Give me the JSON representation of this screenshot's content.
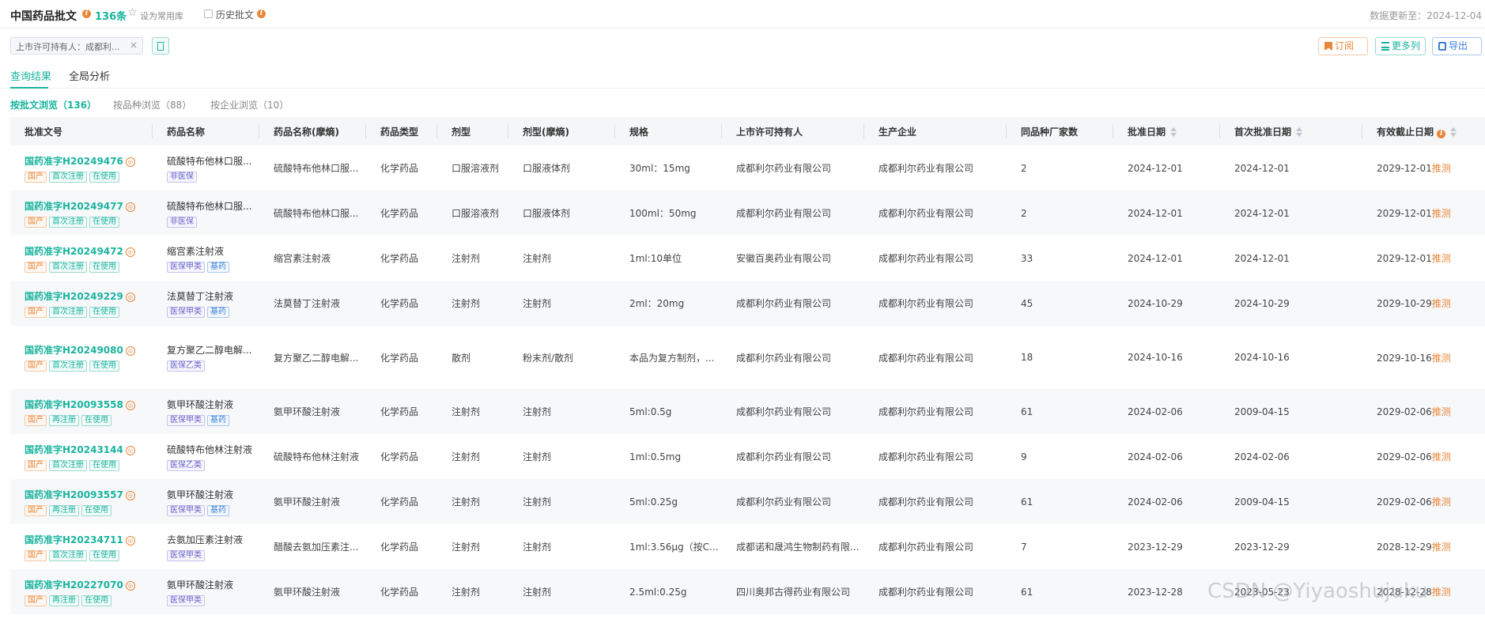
{
  "header": {
    "title": "中国药品批文",
    "count": "136条",
    "set_favorite": "设为常用库",
    "history": "历史批文",
    "updated": "数据更新至：2024-12-04"
  },
  "filter": {
    "chip": "上市许可持有人：成都利...",
    "chip_close": "×"
  },
  "actions": {
    "subscribe": "订阅",
    "more_columns": "更多列",
    "export": "导出"
  },
  "tabs": [
    "查询结果",
    "全局分析"
  ],
  "subtabs": [
    "按批文浏览（136）",
    "按品种浏览（88）",
    "按企业浏览（10）"
  ],
  "columns": [
    "批准文号",
    "药品名称",
    "药品名称(摩熵)",
    "药品类型",
    "剂型",
    "剂型(摩熵)",
    "规格",
    "上市许可持有人",
    "生产企业",
    "同品种厂家数",
    "批准日期",
    "首次批准日期",
    "有效截止日期"
  ],
  "rows": [
    {
      "approval": "国药准字H20249476",
      "tags": [
        "国产",
        "首次注册",
        "在使用"
      ],
      "name": "硫酸特布他林口服...",
      "name_tags": [
        "非医保"
      ],
      "name_ms": "硫酸特布他林口服...",
      "type": "化学药品",
      "form": "口服溶液剂",
      "form_ms": "口服液体剂",
      "spec": "30ml：15mg",
      "holder": "成都利尔药业有限公司",
      "maker": "成都利尔药业有限公司",
      "count": "2",
      "approve_date": "2024-12-01",
      "first_date": "2024-12-01",
      "expire_date": "2029-12-01",
      "predict": "推测"
    },
    {
      "approval": "国药准字H20249477",
      "tags": [
        "国产",
        "首次注册",
        "在使用"
      ],
      "name": "硫酸特布他林口服...",
      "name_tags": [
        "非医保"
      ],
      "name_ms": "硫酸特布他林口服...",
      "type": "化学药品",
      "form": "口服溶液剂",
      "form_ms": "口服液体剂",
      "spec": "100ml：50mg",
      "holder": "成都利尔药业有限公司",
      "maker": "成都利尔药业有限公司",
      "count": "2",
      "approve_date": "2024-12-01",
      "first_date": "2024-12-01",
      "expire_date": "2029-12-01",
      "predict": "推测"
    },
    {
      "approval": "国药准字H20249472",
      "tags": [
        "国产",
        "首次注册",
        "在使用"
      ],
      "name": "缩宫素注射液",
      "name_tags": [
        "医保甲类",
        "基药"
      ],
      "name_ms": "缩宫素注射液",
      "type": "化学药品",
      "form": "注射剂",
      "form_ms": "注射剂",
      "spec": "1ml:10单位",
      "holder": "安徽百奥药业有限公司",
      "maker": "成都利尔药业有限公司",
      "count": "33",
      "approve_date": "2024-12-01",
      "first_date": "2024-12-01",
      "expire_date": "2029-12-01",
      "predict": "推测"
    },
    {
      "approval": "国药准字H20249229",
      "tags": [
        "国产",
        "首次注册",
        "在使用"
      ],
      "name": "法莫替丁注射液",
      "name_tags": [
        "医保甲类",
        "基药"
      ],
      "name_ms": "法莫替丁注射液",
      "type": "化学药品",
      "form": "注射剂",
      "form_ms": "注射剂",
      "spec": "2ml：20mg",
      "holder": "成都利尔药业有限公司",
      "maker": "成都利尔药业有限公司",
      "count": "45",
      "approve_date": "2024-10-29",
      "first_date": "2024-10-29",
      "expire_date": "2029-10-29",
      "predict": "推测"
    },
    {
      "approval": "国药准字H20249080",
      "tags": [
        "国产",
        "首次注册",
        "在使用"
      ],
      "name": "复方聚乙二醇电解...",
      "name_tags": [
        "医保乙类"
      ],
      "name_ms": "复方聚乙二醇电解...",
      "type": "化学药品",
      "form": "散剂",
      "form_ms": "粉末剂/散剂",
      "spec": "本品为复方制剂，...",
      "holder": "成都利尔药业有限公司",
      "maker": "成都利尔药业有限公司",
      "count": "18",
      "approve_date": "2024-10-16",
      "first_date": "2024-10-16",
      "expire_date": "2029-10-16",
      "predict": "推测"
    },
    {
      "approval": "国药准字H20093558",
      "tags": [
        "国产",
        "再注册",
        "在使用"
      ],
      "name": "氨甲环酸注射液",
      "name_tags": [
        "医保甲类",
        "基药"
      ],
      "name_ms": "氨甲环酸注射液",
      "type": "化学药品",
      "form": "注射剂",
      "form_ms": "注射剂",
      "spec": "5ml:0.5g",
      "holder": "成都利尔药业有限公司",
      "maker": "成都利尔药业有限公司",
      "count": "61",
      "approve_date": "2024-02-06",
      "first_date": "2009-04-15",
      "expire_date": "2029-02-06",
      "predict": "推测"
    },
    {
      "approval": "国药准字H20243144",
      "tags": [
        "国产",
        "首次注册",
        "在使用"
      ],
      "name": "硫酸特布他林注射液",
      "name_tags": [
        "医保乙类"
      ],
      "name_ms": "硫酸特布他林注射液",
      "type": "化学药品",
      "form": "注射剂",
      "form_ms": "注射剂",
      "spec": "1ml:0.5mg",
      "holder": "成都利尔药业有限公司",
      "maker": "成都利尔药业有限公司",
      "count": "9",
      "approve_date": "2024-02-06",
      "first_date": "2024-02-06",
      "expire_date": "2029-02-06",
      "predict": "推测"
    },
    {
      "approval": "国药准字H20093557",
      "tags": [
        "国产",
        "再注册",
        "在使用"
      ],
      "name": "氨甲环酸注射液",
      "name_tags": [
        "医保甲类",
        "基药"
      ],
      "name_ms": "氨甲环酸注射液",
      "type": "化学药品",
      "form": "注射剂",
      "form_ms": "注射剂",
      "spec": "5ml:0.25g",
      "holder": "成都利尔药业有限公司",
      "maker": "成都利尔药业有限公司",
      "count": "61",
      "approve_date": "2024-02-06",
      "first_date": "2009-04-15",
      "expire_date": "2029-02-06",
      "predict": "推测"
    },
    {
      "approval": "国药准字H20234711",
      "tags": [
        "国产",
        "首次注册",
        "在使用"
      ],
      "name": "去氨加压素注射液",
      "name_tags": [
        "医保甲类"
      ],
      "name_ms": "醋酸去氨加压素注...",
      "type": "化学药品",
      "form": "注射剂",
      "form_ms": "注射剂",
      "spec": "1ml:3.56μg（按C...",
      "holder": "成都诺和晟鸿生物制药有限...",
      "maker": "成都利尔药业有限公司",
      "count": "7",
      "approve_date": "2023-12-29",
      "first_date": "2023-12-29",
      "expire_date": "2028-12-29",
      "predict": "推测"
    },
    {
      "approval": "国药准字H20227070",
      "tags": [
        "国产",
        "再注册",
        "在使用"
      ],
      "name": "氨甲环酸注射液",
      "name_tags": [
        "医保甲类"
      ],
      "name_ms": "氨甲环酸注射液",
      "type": "化学药品",
      "form": "注射剂",
      "form_ms": "注射剂",
      "spec": "2.5ml:0.25g",
      "holder": "四川奥邦古得药业有限公司",
      "maker": "成都利尔药业有限公司",
      "count": "61",
      "approve_date": "2023-12-28",
      "first_date": "2023-05-23",
      "expire_date": "2028-12-28",
      "predict": "推测"
    }
  ],
  "watermark": "CSDN @Yiyaoshujuku"
}
